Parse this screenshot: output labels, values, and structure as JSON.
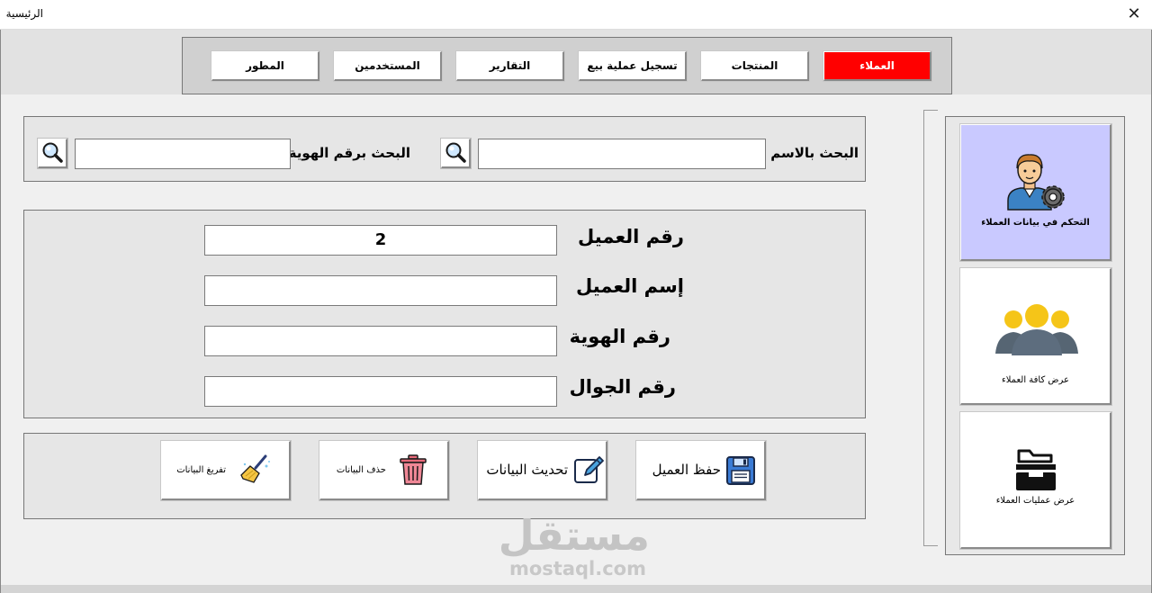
{
  "window": {
    "title": "الرئيسية",
    "close_glyph": "✕"
  },
  "nav": {
    "tabs": [
      {
        "label": "العملاء",
        "active": true
      },
      {
        "label": "المنتجات",
        "active": false
      },
      {
        "label": "تسجيل عملية بيع",
        "active": false
      },
      {
        "label": "التقارير",
        "active": false
      },
      {
        "label": "المستخدمين",
        "active": false
      },
      {
        "label": "المطور",
        "active": false
      }
    ],
    "active_color": "#ff0000"
  },
  "search": {
    "by_name_label": "البحث بالاسم",
    "by_name_value": "",
    "by_id_label": "البحث برقم الهوية",
    "by_id_value": "",
    "button_icon": "magnifier-icon"
  },
  "customer_form": {
    "number_label": "رقم العميل",
    "number_value": "2",
    "name_label": "إسم العميل",
    "name_value": "",
    "id_label": "رقم الهوية",
    "id_value": "",
    "mobile_label": "رقم الجوال",
    "mobile_value": ""
  },
  "actions": {
    "save_label": "حفظ العميل",
    "save_icon": "floppy-disk-icon",
    "update_label": "تحديث البيانات",
    "update_icon": "edit-pencil-icon",
    "delete_label": "حذف البيانات",
    "delete_icon": "trash-icon",
    "clear_label": "تفريغ البيانات",
    "clear_icon": "broom-icon"
  },
  "side_menu": {
    "items": [
      {
        "label": "التحكم في بيانات العملاء",
        "icon": "customer-settings-icon",
        "active": true
      },
      {
        "label": "عرض كافة العملاء",
        "icon": "users-group-icon",
        "active": false
      },
      {
        "label": "عرض عمليات العملاء",
        "icon": "folder-tray-icon",
        "active": false
      }
    ],
    "active_color": "#c9c9ff"
  },
  "watermark": {
    "logo_text": "مستقل",
    "url": "mostaql.com"
  }
}
